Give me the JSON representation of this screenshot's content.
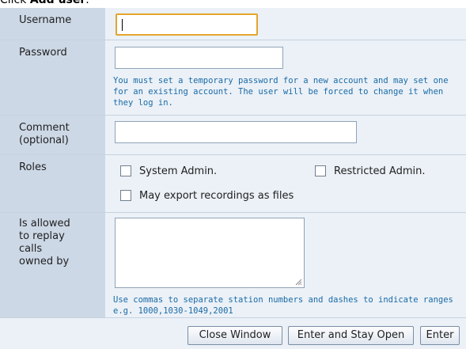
{
  "instruction": {
    "prefix": "Click ",
    "bold": "Add user",
    "suffix": "."
  },
  "form": {
    "username": {
      "label": "Username",
      "value": ""
    },
    "password": {
      "label": "Password",
      "value": "",
      "hint": "You must set a temporary password for a new account and may set one for an existing account. The user will be forced to change it when they log in."
    },
    "comment": {
      "label": "Comment (optional)",
      "value": ""
    },
    "roles": {
      "label": "Roles",
      "options": [
        {
          "label": "System Admin.",
          "checked": false
        },
        {
          "label": "Restricted Admin.",
          "checked": false
        },
        {
          "label": "May export recordings as files",
          "checked": false
        }
      ]
    },
    "replay": {
      "label": "Is allowed to replay calls owned by",
      "value": "",
      "hint": "Use commas to separate station numbers and dashes to indicate ranges e.g. 1000,1030-1049,2001"
    }
  },
  "buttons": {
    "close": "Close Window",
    "enter_stay": "Enter and Stay Open",
    "enter": "Enter"
  }
}
